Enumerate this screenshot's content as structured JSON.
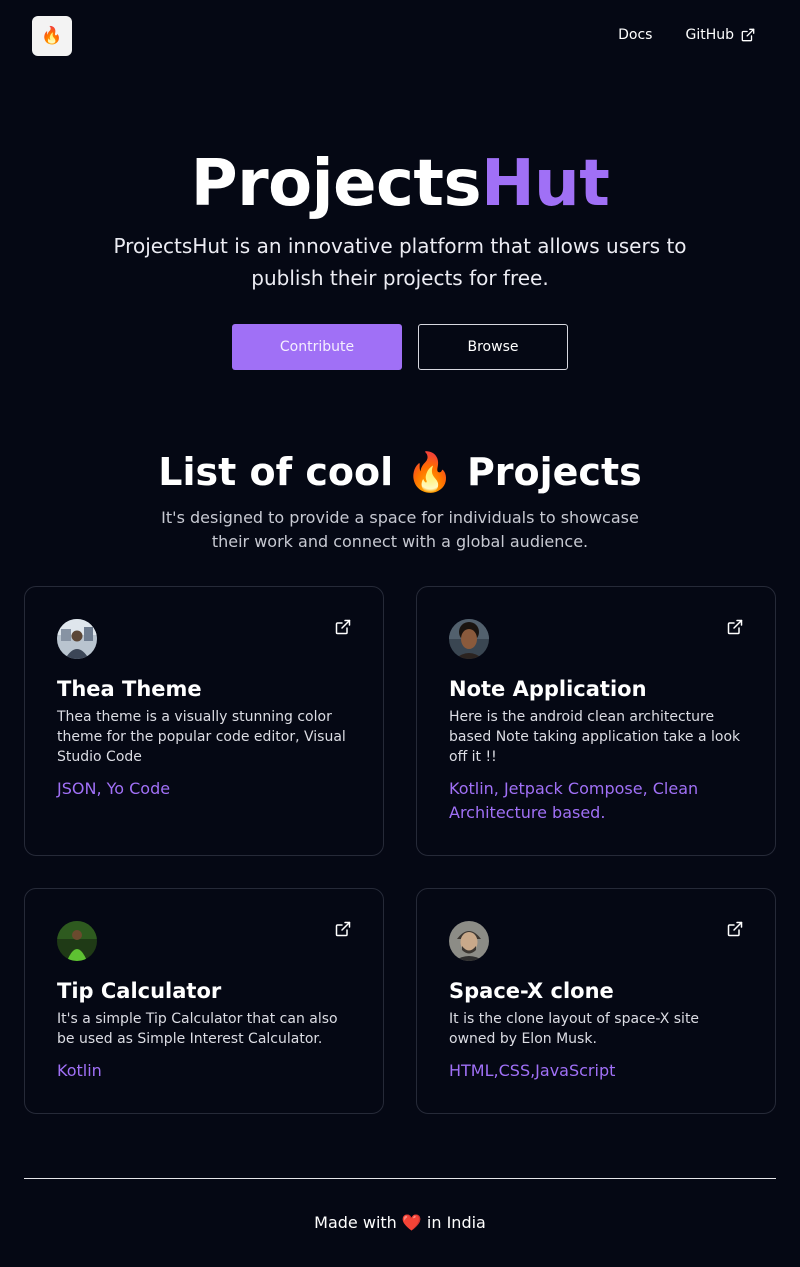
{
  "nav": {
    "logo_icon": "fire-icon",
    "logo_glyph": "🔥",
    "links": [
      {
        "label": "Docs"
      },
      {
        "label": "GitHub",
        "icon": "external-link-icon"
      }
    ]
  },
  "hero": {
    "title_main": "Projects",
    "title_accent": "Hut",
    "subtitle": "ProjectsHut is an innovative platform that allows users to publish their projects for free.",
    "contribute_label": "Contribute",
    "browse_label": "Browse"
  },
  "section": {
    "title_pre": "List of cool",
    "title_emoji": "🔥",
    "title_post": "Projects",
    "subtitle": "It's designed to provide a space for individuals to showcase their work and connect with a global audience."
  },
  "projects": [
    {
      "title": "Thea Theme",
      "description": "Thea theme is a visually stunning color theme for the popular code editor, Visual Studio Code",
      "tags": "JSON, Yo Code"
    },
    {
      "title": "Note Application",
      "description": "Here is the android clean architecture based Note taking application take a look off it !!",
      "tags": "Kotlin, Jetpack Compose, Clean Architecture based."
    },
    {
      "title": "Tip Calculator",
      "description": "It's a simple Tip Calculator that can also be used as Simple Interest Calculator.",
      "tags": "Kotlin"
    },
    {
      "title": "Space-X clone",
      "description": "It is the clone layout of space-X site owned by Elon Musk.",
      "tags": "HTML,CSS,JavaScript"
    }
  ],
  "footer": {
    "pre": "Made with",
    "heart": "❤️",
    "post": "in India"
  },
  "colors": {
    "background": "#050814",
    "accent": "#a070f6",
    "card_border": "#262a38"
  }
}
